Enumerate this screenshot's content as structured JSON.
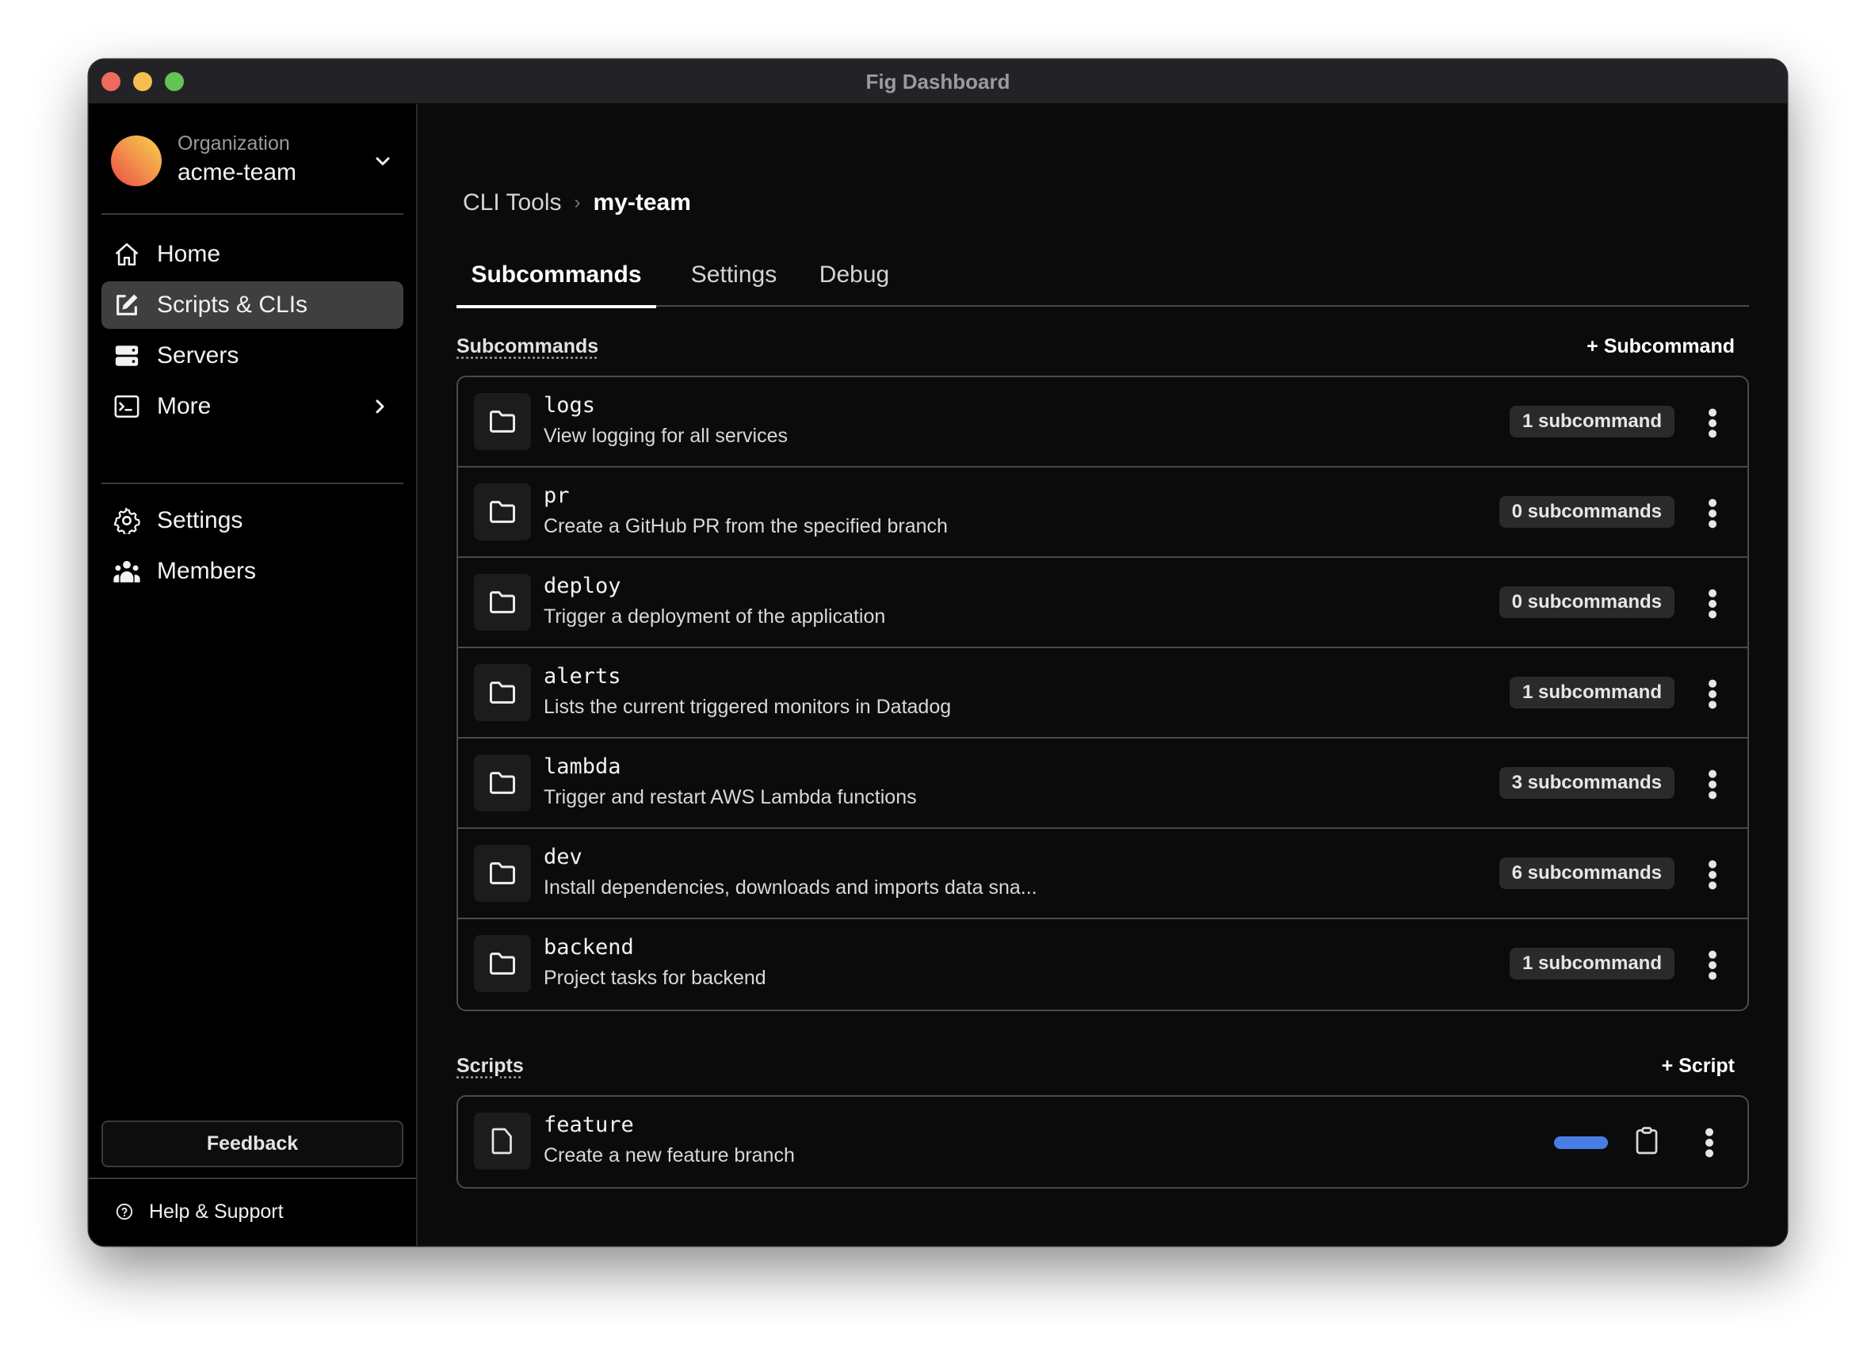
{
  "window": {
    "title": "Fig Dashboard"
  },
  "sidebar": {
    "org_label": "Organization",
    "org_name": "acme-team",
    "nav_items": [
      {
        "label": "Home",
        "icon": "home-icon"
      },
      {
        "label": "Scripts & CLIs",
        "icon": "edit-icon",
        "active": true
      },
      {
        "label": "Servers",
        "icon": "server-icon"
      },
      {
        "label": "More",
        "icon": "terminal-icon",
        "has_submenu": true
      },
      {
        "label": "Settings",
        "icon": "gear-icon"
      },
      {
        "label": "Members",
        "icon": "users-icon"
      }
    ],
    "feedback_label": "Feedback",
    "help_label": "Help & Support"
  },
  "main": {
    "breadcrumb": [
      "CLI Tools",
      "my-team"
    ],
    "tabs": [
      {
        "label": "Subcommands",
        "active": true
      },
      {
        "label": "Settings"
      },
      {
        "label": "Debug"
      }
    ],
    "subcommands": {
      "title": "Subcommands",
      "add_label": "+ Subcommand",
      "items": [
        {
          "name": "logs",
          "description": "View logging for all services",
          "count": "1 subcommand"
        },
        {
          "name": "pr",
          "description": "Create a GitHub PR from the specified branch",
          "count": "0 subcommands"
        },
        {
          "name": "deploy",
          "description": "Trigger a deployment of the application",
          "count": "0 subcommands"
        },
        {
          "name": "alerts",
          "description": "Lists the current triggered monitors in Datadog",
          "count": "1 subcommand"
        },
        {
          "name": "lambda",
          "description": "Trigger and restart AWS Lambda functions",
          "count": "3 subcommands"
        },
        {
          "name": "dev",
          "description": "Install dependencies, downloads and imports data sna...",
          "count": "6 subcommands"
        },
        {
          "name": "backend",
          "description": "Project tasks for backend",
          "count": "1 subcommand"
        }
      ]
    },
    "scripts": {
      "title": "Scripts",
      "add_label": "+ Script",
      "items": [
        {
          "name": "feature",
          "description": "Create a new feature branch",
          "enabled": true
        }
      ]
    }
  },
  "colors": {
    "accent": "#4a7ce6",
    "active_nav_bg": "#3f3f3f",
    "badge_bg": "#2a2a2a",
    "border": "#4a4a4a"
  }
}
